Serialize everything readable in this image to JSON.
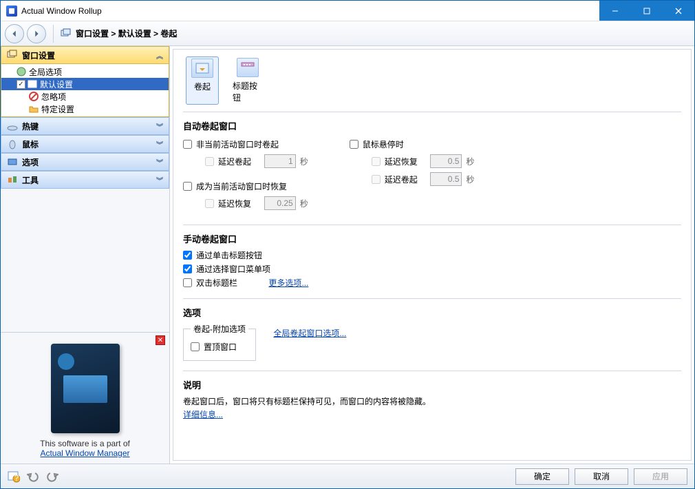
{
  "window": {
    "title": "Actual Window Rollup"
  },
  "breadcrumb": {
    "root": "窗口设置",
    "mid": "默认设置",
    "leaf": "卷起"
  },
  "sidebar": {
    "sections": [
      {
        "label": "窗口设置"
      },
      {
        "label": "热键"
      },
      {
        "label": "鼠标"
      },
      {
        "label": "选项"
      },
      {
        "label": "工具"
      }
    ],
    "tree": {
      "global": "全局选项",
      "default_settings": "默认设置",
      "ignore": "忽略项",
      "specific": "特定设置"
    },
    "promo_text": "This software is a part of",
    "promo_link": "Actual Window Manager"
  },
  "tabs": {
    "rollup": "卷起",
    "title_buttons": "标题按钮"
  },
  "auto": {
    "title": "自动卷起窗口",
    "not_active": "非当前活动窗口时卷起",
    "delay_rollup": "延迟卷起",
    "delay_rollup_val": "1",
    "seconds": "秒",
    "become_active_restore": "成为当前活动窗口时恢复",
    "delay_restore": "延迟恢复",
    "delay_restore_val": "0.25",
    "hover": "鼠标悬停时",
    "hover_delay_restore": "延迟恢复",
    "hover_delay_restore_val": "0.5",
    "hover_delay_rollup": "延迟卷起",
    "hover_delay_rollup_val": "0.5"
  },
  "manual": {
    "title": "手动卷起窗口",
    "click_titlebtn": "通过单击标题按钮",
    "select_menu": "通过选择窗口菜单项",
    "dblclick_title": "双击标题栏",
    "more": "更多选项..."
  },
  "options": {
    "title": "选项",
    "fieldset_legend": "卷起-附加选项",
    "topmost": "置顶窗口",
    "global_link": "全局卷起窗口选项..."
  },
  "desc": {
    "title": "说明",
    "text": "卷起窗口后，窗口将只有标题栏保持可见，而窗口的内容将被隐藏。",
    "link": "详细信息..."
  },
  "footer": {
    "ok": "确定",
    "cancel": "取消",
    "apply": "应用"
  }
}
